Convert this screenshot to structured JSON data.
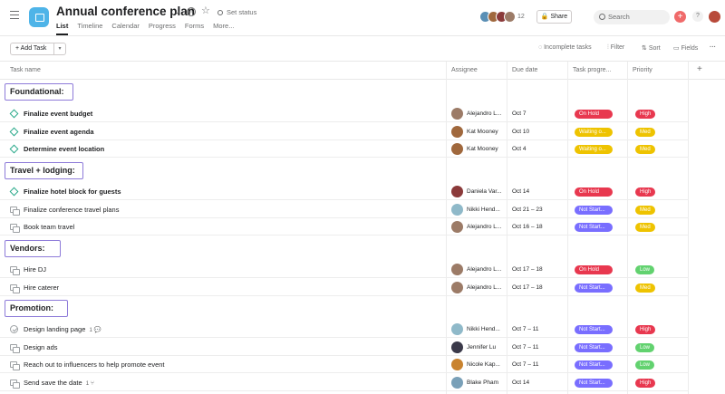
{
  "project": {
    "title": "Annual conference plan",
    "set_status": "Set status",
    "tabs": [
      "List",
      "Timeline",
      "Calendar",
      "Progress",
      "Forms",
      "More..."
    ],
    "member_count": "12",
    "share_label": "Share",
    "search_placeholder": "Search"
  },
  "toolbar": {
    "add_task": "+ Add Task",
    "incomplete": "Incomplete tasks",
    "filter": "Filter",
    "sort": "Sort",
    "fields": "Fields",
    "more": "···"
  },
  "columns": {
    "task_name": "Task name",
    "assignee": "Assignee",
    "due_date": "Due date",
    "progress": "Task progre...",
    "priority": "Priority",
    "add": "+"
  },
  "colors": {
    "on_hold": "#e8384f",
    "waiting": "#eec300",
    "not_started": "#796eff",
    "high": "#e8384f",
    "med": "#eec300",
    "low": "#62d26f",
    "section_border": "#8e7bd9"
  },
  "sections": [
    {
      "title": "Foundational:",
      "tasks": [
        {
          "icon": "milestone-icon",
          "name": "Finalize event budget",
          "bold": true,
          "extra": "",
          "assignee": "Alejandro L...",
          "avatar": "#9c7b67",
          "due": "Oct 7",
          "status": "On Hold",
          "status_color": "#e8384f",
          "priority": "High",
          "priority_color": "#e8384f"
        },
        {
          "icon": "milestone-icon",
          "name": "Finalize event agenda",
          "bold": true,
          "extra": "",
          "assignee": "Kat Mooney",
          "avatar": "#a0683d",
          "due": "Oct 10",
          "status": "Waiting o...",
          "status_color": "#eec300",
          "priority": "Med",
          "priority_color": "#eec300"
        },
        {
          "icon": "milestone-icon",
          "name": "Determine event location",
          "bold": true,
          "extra": "",
          "assignee": "Kat Mooney",
          "avatar": "#a0683d",
          "due": "Oct 4",
          "status": "Waiting o...",
          "status_color": "#eec300",
          "priority": "Med",
          "priority_color": "#eec300"
        }
      ]
    },
    {
      "title": "Travel + lodging:",
      "tasks": [
        {
          "icon": "milestone-icon",
          "name": "Finalize hotel block for guests",
          "bold": true,
          "extra": "",
          "assignee": "Daniela Var...",
          "avatar": "#8b3a3a",
          "due": "Oct 14",
          "status": "On Hold",
          "status_color": "#e8384f",
          "priority": "High",
          "priority_color": "#e8384f"
        },
        {
          "icon": "subtask-icon",
          "name": "Finalize conference travel plans",
          "bold": false,
          "extra": "",
          "assignee": "Nikki Hend...",
          "avatar": "#8fb9c9",
          "due": "Oct 21 – 23",
          "status": "Not Start...",
          "status_color": "#796eff",
          "priority": "Med",
          "priority_color": "#eec300"
        },
        {
          "icon": "subtask-icon",
          "name": "Book team travel",
          "bold": false,
          "extra": "",
          "assignee": "Alejandro L...",
          "avatar": "#9c7b67",
          "due": "Oct 16 – 18",
          "status": "Not Start...",
          "status_color": "#796eff",
          "priority": "Med",
          "priority_color": "#eec300"
        }
      ]
    },
    {
      "title": "Vendors:",
      "tasks": [
        {
          "icon": "subtask-icon",
          "name": "Hire DJ",
          "bold": false,
          "extra": "",
          "assignee": "Alejandro L...",
          "avatar": "#9c7b67",
          "due": "Oct 17 – 18",
          "status": "On Hold",
          "status_color": "#e8384f",
          "priority": "Low",
          "priority_color": "#62d26f"
        },
        {
          "icon": "subtask-icon",
          "name": "Hire caterer",
          "bold": false,
          "extra": "",
          "assignee": "Alejandro L...",
          "avatar": "#9c7b67",
          "due": "Oct 17 – 18",
          "status": "Not Start...",
          "status_color": "#796eff",
          "priority": "Med",
          "priority_color": "#eec300"
        }
      ]
    },
    {
      "title": "Promotion:",
      "tasks": [
        {
          "icon": "check-circle-icon",
          "name": "Design landing page",
          "bold": false,
          "extra": "1 💬",
          "assignee": "Nikki Hend...",
          "avatar": "#8fb9c9",
          "due": "Oct 7 – 11",
          "status": "Not Start...",
          "status_color": "#796eff",
          "priority": "High",
          "priority_color": "#e8384f"
        },
        {
          "icon": "subtask-icon",
          "name": "Design ads",
          "bold": false,
          "extra": "",
          "assignee": "Jennifer Lu",
          "avatar": "#3b3a4a",
          "due": "Oct 7 – 11",
          "status": "Not Start...",
          "status_color": "#796eff",
          "priority": "Low",
          "priority_color": "#62d26f"
        },
        {
          "icon": "subtask-icon",
          "name": "Reach out to influencers to help promote event",
          "bold": false,
          "extra": "",
          "assignee": "Nicole Kap...",
          "avatar": "#c9832f",
          "due": "Oct 7 – 11",
          "status": "Not Start...",
          "status_color": "#796eff",
          "priority": "Low",
          "priority_color": "#62d26f"
        },
        {
          "icon": "subtask-icon",
          "name": "Send save the date",
          "bold": false,
          "extra": "1 ⑂",
          "assignee": "Blake Pham",
          "avatar": "#7aa0b8",
          "due": "Oct 14",
          "status": "Not Start...",
          "status_color": "#796eff",
          "priority": "High",
          "priority_color": "#e8384f"
        }
      ]
    }
  ]
}
